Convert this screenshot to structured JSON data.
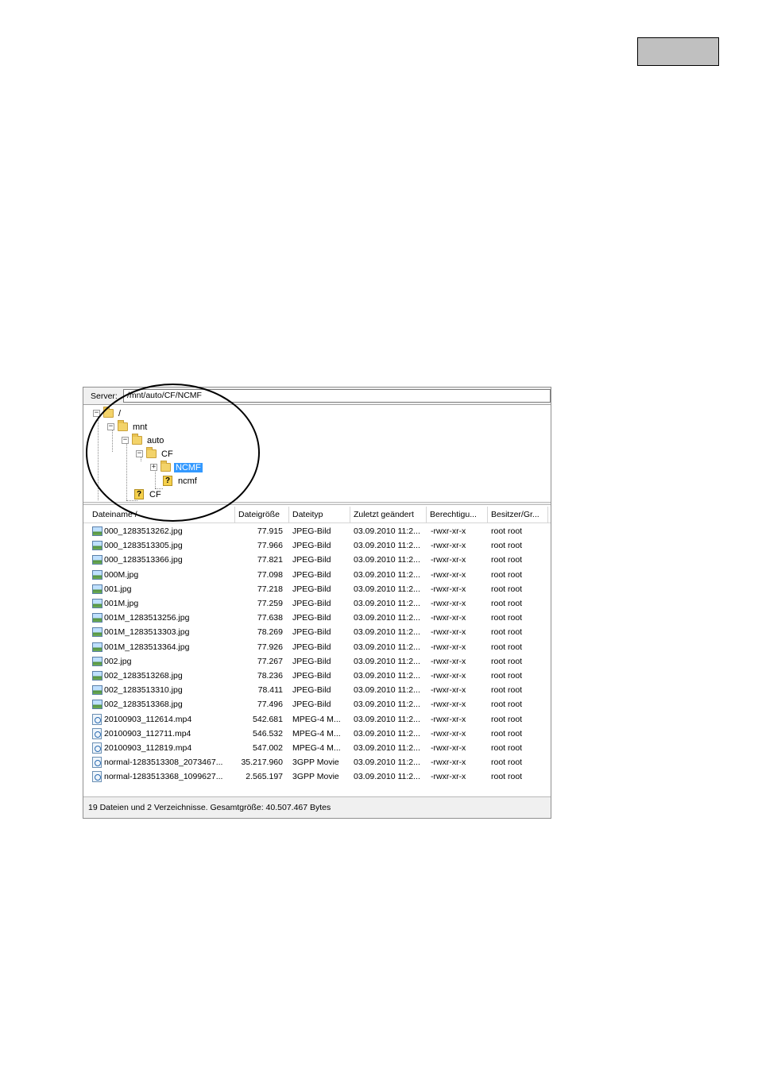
{
  "server": {
    "label": "Server:",
    "path": "/mnt/auto/CF/NCMF"
  },
  "tree": {
    "root": "/",
    "mnt": "mnt",
    "auto": "auto",
    "cf": "CF",
    "ncmf_upper": "NCMF",
    "ncmf_lower": "ncmf",
    "cf_unknown": "CF"
  },
  "columns": [
    "Dateiname  /",
    "Dateigröße",
    "Dateityp",
    "Zuletzt geändert",
    "Berechtigu...",
    "Besitzer/Gr..."
  ],
  "files": [
    {
      "name": "000_1283513262.jpg",
      "size": "77.915",
      "type": "JPEG-Bild",
      "modified": "03.09.2010 11:2...",
      "perms": "-rwxr-xr-x",
      "owner": "root root",
      "icon": "image-file-icon"
    },
    {
      "name": "000_1283513305.jpg",
      "size": "77.966",
      "type": "JPEG-Bild",
      "modified": "03.09.2010 11:2...",
      "perms": "-rwxr-xr-x",
      "owner": "root root",
      "icon": "image-file-icon"
    },
    {
      "name": "000_1283513366.jpg",
      "size": "77.821",
      "type": "JPEG-Bild",
      "modified": "03.09.2010 11:2...",
      "perms": "-rwxr-xr-x",
      "owner": "root root",
      "icon": "image-file-icon"
    },
    {
      "name": "000M.jpg",
      "size": "77.098",
      "type": "JPEG-Bild",
      "modified": "03.09.2010 11:2...",
      "perms": "-rwxr-xr-x",
      "owner": "root root",
      "icon": "image-file-icon"
    },
    {
      "name": "001.jpg",
      "size": "77.218",
      "type": "JPEG-Bild",
      "modified": "03.09.2010 11:2...",
      "perms": "-rwxr-xr-x",
      "owner": "root root",
      "icon": "image-file-icon"
    },
    {
      "name": "001M.jpg",
      "size": "77.259",
      "type": "JPEG-Bild",
      "modified": "03.09.2010 11:2...",
      "perms": "-rwxr-xr-x",
      "owner": "root root",
      "icon": "image-file-icon"
    },
    {
      "name": "001M_1283513256.jpg",
      "size": "77.638",
      "type": "JPEG-Bild",
      "modified": "03.09.2010 11:2...",
      "perms": "-rwxr-xr-x",
      "owner": "root root",
      "icon": "image-file-icon"
    },
    {
      "name": "001M_1283513303.jpg",
      "size": "78.269",
      "type": "JPEG-Bild",
      "modified": "03.09.2010 11:2...",
      "perms": "-rwxr-xr-x",
      "owner": "root root",
      "icon": "image-file-icon"
    },
    {
      "name": "001M_1283513364.jpg",
      "size": "77.926",
      "type": "JPEG-Bild",
      "modified": "03.09.2010 11:2...",
      "perms": "-rwxr-xr-x",
      "owner": "root root",
      "icon": "image-file-icon"
    },
    {
      "name": "002.jpg",
      "size": "77.267",
      "type": "JPEG-Bild",
      "modified": "03.09.2010 11:2...",
      "perms": "-rwxr-xr-x",
      "owner": "root root",
      "icon": "image-file-icon"
    },
    {
      "name": "002_1283513268.jpg",
      "size": "78.236",
      "type": "JPEG-Bild",
      "modified": "03.09.2010 11:2...",
      "perms": "-rwxr-xr-x",
      "owner": "root root",
      "icon": "image-file-icon"
    },
    {
      "name": "002_1283513310.jpg",
      "size": "78.411",
      "type": "JPEG-Bild",
      "modified": "03.09.2010 11:2...",
      "perms": "-rwxr-xr-x",
      "owner": "root root",
      "icon": "image-file-icon"
    },
    {
      "name": "002_1283513368.jpg",
      "size": "77.496",
      "type": "JPEG-Bild",
      "modified": "03.09.2010 11:2...",
      "perms": "-rwxr-xr-x",
      "owner": "root root",
      "icon": "image-file-icon"
    },
    {
      "name": "20100903_112614.mp4",
      "size": "542.681",
      "type": "MPEG-4 M...",
      "modified": "03.09.2010 11:2...",
      "perms": "-rwxr-xr-x",
      "owner": "root root",
      "icon": "video-file-icon"
    },
    {
      "name": "20100903_112711.mp4",
      "size": "546.532",
      "type": "MPEG-4 M...",
      "modified": "03.09.2010 11:2...",
      "perms": "-rwxr-xr-x",
      "owner": "root root",
      "icon": "video-file-icon"
    },
    {
      "name": "20100903_112819.mp4",
      "size": "547.002",
      "type": "MPEG-4 M...",
      "modified": "03.09.2010 11:2...",
      "perms": "-rwxr-xr-x",
      "owner": "root root",
      "icon": "video-file-icon"
    },
    {
      "name": "normal-1283513308_2073467...",
      "size": "35.217.960",
      "type": "3GPP Movie",
      "modified": "03.09.2010 11:2...",
      "perms": "-rwxr-xr-x",
      "owner": "root root",
      "icon": "video-file-icon"
    },
    {
      "name": "normal-1283513368_1099627...",
      "size": "2.565.197",
      "type": "3GPP Movie",
      "modified": "03.09.2010 11:2...",
      "perms": "-rwxr-xr-x",
      "owner": "root root",
      "icon": "video-file-icon"
    }
  ],
  "status": "19 Dateien und 2 Verzeichnisse. Gesamtgröße: 40.507.467 Bytes",
  "colors": {
    "selection": "#3399ff",
    "panel_bg": "#f0f0f0",
    "page_tab": "#c0c0c0"
  }
}
